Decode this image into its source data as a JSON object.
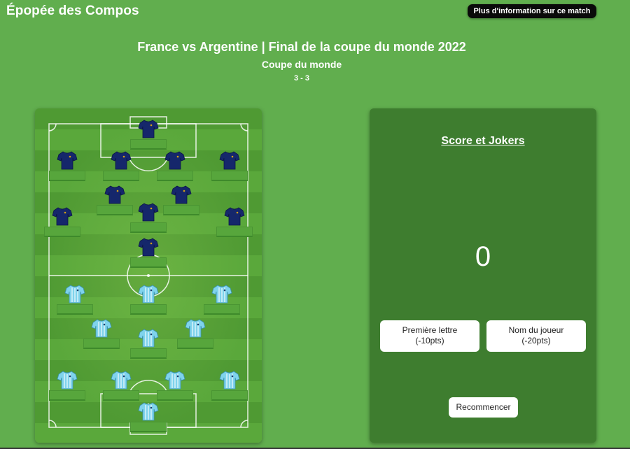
{
  "header": {
    "site_title": "Épopée des Compos",
    "info_button": "Plus d'information sur ce match"
  },
  "match": {
    "title": "France vs Argentine | Final de la coupe du monde 2022",
    "competition": "Coupe du monde",
    "score": "3 - 3"
  },
  "panel": {
    "title": "Score et Jokers",
    "score": "0",
    "jokers": [
      {
        "line1": "Première lettre",
        "line2": "(-10pts)"
      },
      {
        "line1": "Nom du joueur",
        "line2": "(-20pts)"
      }
    ],
    "restart": "Recommencer"
  },
  "colors": {
    "page_bg": "#61ae4e",
    "panel_bg": "#3e7d2f",
    "team_top_shirt": "#15276b",
    "team_bottom_shirt": "#7fd3ec"
  },
  "teams": {
    "top_team_count": 11,
    "bottom_team_count": 11
  }
}
